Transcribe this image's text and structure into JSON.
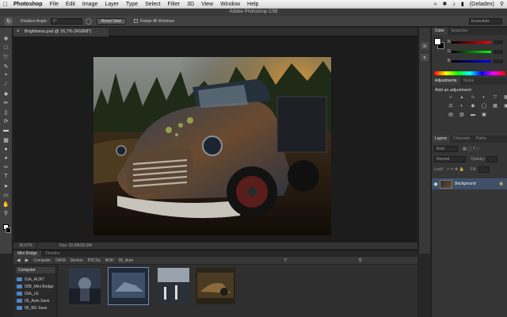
{
  "menubar": {
    "apple": "",
    "items": [
      "Photoshop",
      "File",
      "Edit",
      "Image",
      "Layer",
      "Type",
      "Select",
      "Filter",
      "3D",
      "View",
      "Window",
      "Help"
    ],
    "right_user": "(Geladen)"
  },
  "window": {
    "title": "Adobe Photoshop CS6"
  },
  "options": {
    "rotation_label": "Rotation Angle:",
    "rotation_value": "0°",
    "reset_view": "Reset View",
    "rotate_all": "Rotate All Windows",
    "workspace": "Essentials"
  },
  "document": {
    "tab_title": "Brightness.psd @ 16,7% (RGB/8*)",
    "zoom": "16,67%",
    "doc_info": "Doc: 32,6M/32,6M"
  },
  "panels": {
    "color_tabs": [
      "Color",
      "Swatches"
    ],
    "color_channels": [
      "R",
      "G",
      "B"
    ],
    "adjustments_tabs": [
      "Adjustments",
      "Styles"
    ],
    "adjustments_title": "Add an adjustment",
    "layers_tabs": [
      "Layers",
      "Channels",
      "Paths"
    ],
    "layer_kind": "Kind",
    "blend_mode": "Normal",
    "opacity_label": "Opacity:",
    "lock_label": "Lock:",
    "fill_label": "Fill:",
    "layer_name": "Background",
    "minicol_icons": [
      "history-icon",
      "properties-icon"
    ]
  },
  "bridge": {
    "tabs": [
      "Mini Bridge",
      "Timeline"
    ],
    "path": [
      "Computer",
      "DATA",
      "Demos",
      "PSCSs",
      "BOH",
      "05_Auto"
    ],
    "location": "Computer",
    "folders": [
      "01A_ACR7",
      "02B_Mini Bridge",
      "03A_LE",
      "05_Auto Save",
      "06_BG Save"
    ]
  }
}
